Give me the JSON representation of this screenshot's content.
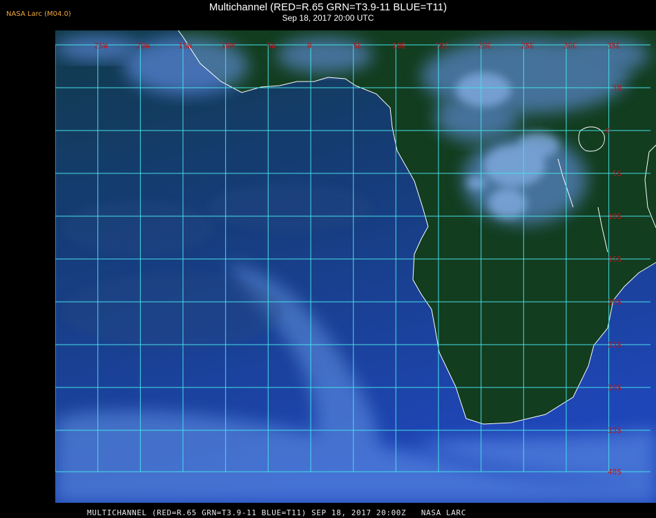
{
  "header": {
    "badge": "NASA Larc (M04.0)",
    "title": "Multichannel (RED=R.65 GRN=T3.9-11 BLUE=T11)",
    "subtitle": "Sep 18, 2017 20:00 UTC"
  },
  "footer": {
    "caption": "MULTICHANNEL (RED=R.65 GRN=T3.9-11 BLUE=T11) SEP 18, 2017 20:00Z   NASA LARC"
  },
  "map": {
    "projection": "equirectangular",
    "lon_range": [
      -30,
      40
    ],
    "lat_range": [
      -40,
      10
    ],
    "lon_labels": [
      "25W",
      "20W",
      "15W",
      "10W",
      "5W",
      "0",
      "5E",
      "10E",
      "15E",
      "20E",
      "25E",
      "30E",
      "35E"
    ],
    "lat_labels": [
      "5N",
      "0",
      "5S",
      "10S",
      "15S",
      "20S",
      "25S",
      "30S",
      "35S",
      "40S"
    ],
    "colors": {
      "grid": "#45e0e8",
      "label": "#c0141a",
      "coast": "#ffffff",
      "ocean": "#1b3f8a",
      "land": "#103a1c",
      "cloud": "#7fb4ff"
    }
  }
}
